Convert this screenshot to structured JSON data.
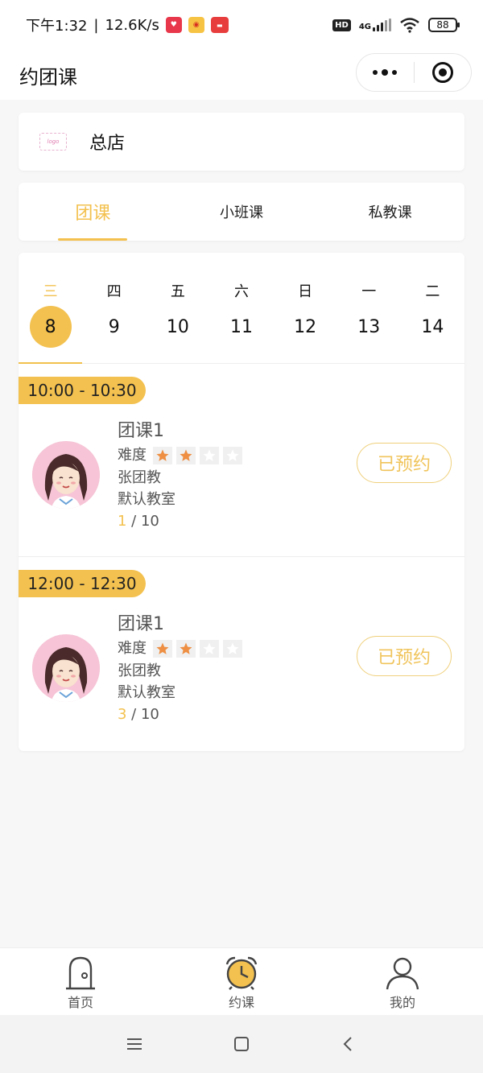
{
  "status_bar": {
    "time": "下午1:32",
    "speed": "12.6K/s",
    "net_type": "4G",
    "battery": "88",
    "colors": {
      "app1": "#e8364a",
      "app2": "#f0a51b",
      "app3": "#e83d3d"
    }
  },
  "nav": {
    "title": "约团课"
  },
  "store": {
    "name": "总店",
    "logo_text": "logo"
  },
  "tabs": [
    {
      "label": "团课",
      "active": true
    },
    {
      "label": "小班课",
      "active": false
    },
    {
      "label": "私教课",
      "active": false
    }
  ],
  "days": [
    {
      "weekday": "三",
      "date": "8",
      "active": true
    },
    {
      "weekday": "四",
      "date": "9"
    },
    {
      "weekday": "五",
      "date": "10"
    },
    {
      "weekday": "六",
      "date": "11"
    },
    {
      "weekday": "日",
      "date": "12"
    },
    {
      "weekday": "一",
      "date": "13"
    },
    {
      "weekday": "二",
      "date": "14"
    }
  ],
  "sessions": [
    {
      "time": "10:00 - 10:30",
      "course": "团课1",
      "difficulty_label": "难度",
      "difficulty": 2,
      "difficulty_max": 4,
      "coach": "张团教",
      "room": "默认教室",
      "booked": "1",
      "capacity": "10",
      "capacity_sep": " / ",
      "status": "已预约"
    },
    {
      "time": "12:00 - 12:30",
      "course": "团课1",
      "difficulty_label": "难度",
      "difficulty": 2,
      "difficulty_max": 4,
      "coach": "张团教",
      "room": "默认教室",
      "booked": "3",
      "capacity": "10",
      "capacity_sep": " / ",
      "status": "已预约"
    }
  ],
  "tabbar": [
    {
      "label": "首页",
      "icon": "door-icon"
    },
    {
      "label": "约课",
      "icon": "alarm-clock-icon",
      "active": true
    },
    {
      "label": "我的",
      "icon": "user-icon"
    }
  ],
  "theme": {
    "accent": "#f3c14f",
    "star": "#ee8f43"
  }
}
